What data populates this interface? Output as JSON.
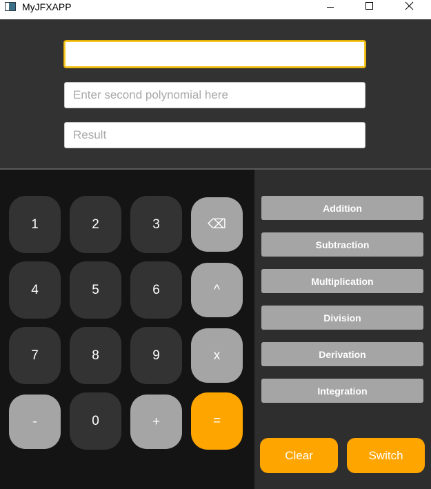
{
  "window": {
    "title": "MyJFXAPP"
  },
  "inputs": {
    "first": {
      "value": "",
      "placeholder": ""
    },
    "second": {
      "value": "",
      "placeholder": "Enter second polynomial here"
    },
    "result": {
      "value": "",
      "placeholder": "Result"
    }
  },
  "keypad": {
    "k1": "1",
    "k2": "2",
    "k3": "3",
    "backspace": "⌫",
    "k4": "4",
    "k5": "5",
    "k6": "6",
    "power": "^",
    "k7": "7",
    "k8": "8",
    "k9": "9",
    "x": "x",
    "minus": "-",
    "k0": "0",
    "plus": "+",
    "equals": "="
  },
  "operations": {
    "addition": "Addition",
    "subtraction": "Subtraction",
    "multiplication": "Multiplication",
    "division": "Division",
    "derivation": "Derivation",
    "integration": "Integration"
  },
  "actions": {
    "clear": "Clear",
    "switch": "Switch"
  },
  "colors": {
    "accent": "#ffa500",
    "key_dark": "#333333",
    "key_gray": "#a5a5a5",
    "focus_border": "#f3c623"
  }
}
